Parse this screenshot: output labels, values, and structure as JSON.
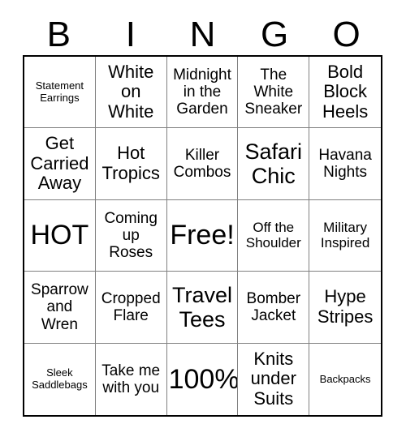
{
  "card": {
    "title": "BINGO",
    "header_letters": [
      "B",
      "I",
      "N",
      "G",
      "O"
    ],
    "colors": {
      "background": "#ffffff",
      "text": "#000000",
      "outer_border": "#000000",
      "inner_border": "#808080"
    },
    "grid": {
      "columns": 5,
      "rows": 5,
      "cells": [
        {
          "text": "Statement\nEarrings",
          "size": "xs"
        },
        {
          "text": "White\non\nWhite",
          "size": "lg"
        },
        {
          "text": "Midnight\nin the\nGarden",
          "size": "md"
        },
        {
          "text": "The\nWhite\nSneaker",
          "size": "md"
        },
        {
          "text": "Bold\nBlock\nHeels",
          "size": "lg"
        },
        {
          "text": "Get\nCarried\nAway",
          "size": "lg"
        },
        {
          "text": "Hot\nTropics",
          "size": "lg"
        },
        {
          "text": "Killer\nCombos",
          "size": "md"
        },
        {
          "text": "Safari\nChic",
          "size": "xl"
        },
        {
          "text": "Havana\nNights",
          "size": "md"
        },
        {
          "text": "HOT",
          "size": "xxl"
        },
        {
          "text": "Coming\nup\nRoses",
          "size": "md"
        },
        {
          "text": "Free!",
          "size": "xxl"
        },
        {
          "text": "Off the\nShoulder",
          "size": "sm"
        },
        {
          "text": "Military\nInspired",
          "size": "sm"
        },
        {
          "text": "Sparrow\nand\nWren",
          "size": "md"
        },
        {
          "text": "Cropped\nFlare",
          "size": "md"
        },
        {
          "text": "Travel\nTees",
          "size": "xl"
        },
        {
          "text": "Bomber\nJacket",
          "size": "md"
        },
        {
          "text": "Hype\nStripes",
          "size": "lg"
        },
        {
          "text": "Sleek\nSaddlebags",
          "size": "xs"
        },
        {
          "text": "Take me\nwith you",
          "size": "md"
        },
        {
          "text": "100%",
          "size": "xxl"
        },
        {
          "text": "Knits\nunder\nSuits",
          "size": "lg"
        },
        {
          "text": "Backpacks",
          "size": "xs"
        }
      ]
    }
  }
}
